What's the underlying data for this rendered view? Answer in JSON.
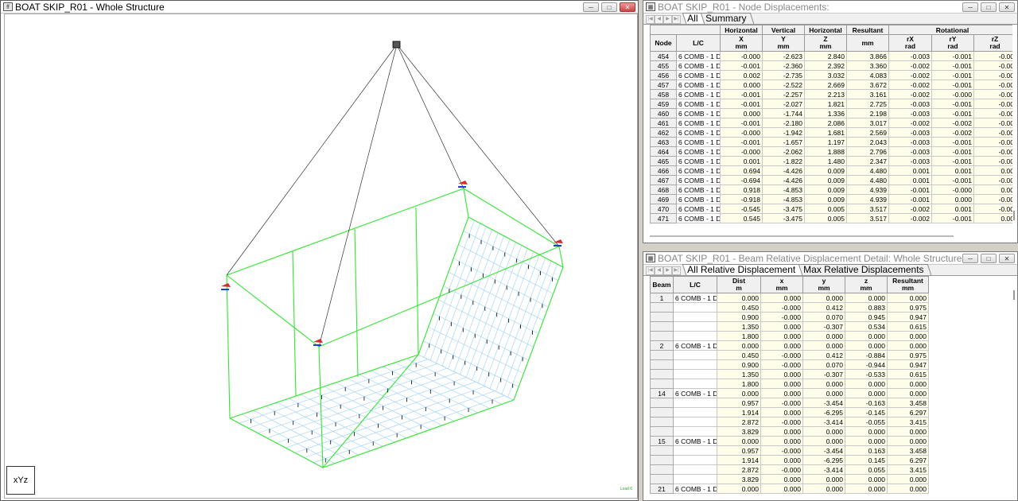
{
  "structure_window": {
    "title": "BOAT SKIP_R01 - Whole Structure",
    "axes_label": "xYz",
    "load_label": "Load 6"
  },
  "node_window": {
    "title": "BOAT SKIP_R01 - Node Displacements:",
    "tabs": [
      "All",
      "Summary"
    ],
    "group_headers": [
      "Horizontal",
      "Vertical",
      "Horizontal",
      "Resultant",
      "Rotational"
    ],
    "col_headers": [
      {
        "name": "Node",
        "unit": ""
      },
      {
        "name": "L/C",
        "unit": ""
      },
      {
        "name": "X",
        "unit": "mm"
      },
      {
        "name": "Y",
        "unit": "mm"
      },
      {
        "name": "Z",
        "unit": "mm"
      },
      {
        "name": "",
        "unit": "mm"
      },
      {
        "name": "rX",
        "unit": "rad"
      },
      {
        "name": "rY",
        "unit": "rad"
      },
      {
        "name": "rZ",
        "unit": "rad"
      }
    ],
    "rows": [
      [
        "454",
        "6 COMB - 1 D",
        "-0.000",
        "-2.623",
        "2.840",
        "3.866",
        "-0.003",
        "-0.001",
        "-0.00"
      ],
      [
        "455",
        "6 COMB - 1 D",
        "-0.001",
        "-2.360",
        "2.392",
        "3.360",
        "-0.002",
        "-0.001",
        "-0.00"
      ],
      [
        "456",
        "6 COMB - 1 D",
        "0.002",
        "-2.735",
        "3.032",
        "4.083",
        "-0.002",
        "-0.001",
        "-0.00"
      ],
      [
        "457",
        "6 COMB - 1 D",
        "0.000",
        "-2.522",
        "2.669",
        "3.672",
        "-0.002",
        "-0.001",
        "-0.00"
      ],
      [
        "458",
        "6 COMB - 1 D",
        "-0.001",
        "-2.257",
        "2.213",
        "3.161",
        "-0.002",
        "-0.000",
        "-0.00"
      ],
      [
        "459",
        "6 COMB - 1 D",
        "-0.001",
        "-2.027",
        "1.821",
        "2.725",
        "-0.003",
        "-0.001",
        "-0.00"
      ],
      [
        "460",
        "6 COMB - 1 D",
        "0.000",
        "-1.744",
        "1.336",
        "2.198",
        "-0.003",
        "-0.001",
        "-0.00"
      ],
      [
        "461",
        "6 COMB - 1 D",
        "-0.001",
        "-2.180",
        "2.086",
        "3.017",
        "-0.002",
        "-0.002",
        "-0.00"
      ],
      [
        "462",
        "6 COMB - 1 D",
        "-0.000",
        "-1.942",
        "1.681",
        "2.569",
        "-0.003",
        "-0.002",
        "-0.00"
      ],
      [
        "463",
        "6 COMB - 1 D",
        "-0.001",
        "-1.657",
        "1.197",
        "2.043",
        "-0.003",
        "-0.001",
        "-0.00"
      ],
      [
        "464",
        "6 COMB - 1 D",
        "-0.000",
        "-2.062",
        "1.888",
        "2.796",
        "-0.003",
        "-0.001",
        "-0.00"
      ],
      [
        "465",
        "6 COMB - 1 D",
        "0.001",
        "-1.822",
        "1.480",
        "2.347",
        "-0.003",
        "-0.001",
        "-0.00"
      ],
      [
        "466",
        "6 COMB - 1 D",
        "0.694",
        "-4.426",
        "0.009",
        "4.480",
        "0.001",
        "0.001",
        "0.00"
      ],
      [
        "467",
        "6 COMB - 1 D",
        "-0.694",
        "-4.426",
        "0.009",
        "4.480",
        "0.001",
        "-0.001",
        "-0.00"
      ],
      [
        "468",
        "6 COMB - 1 D",
        "0.918",
        "-4.853",
        "0.009",
        "4.939",
        "-0.001",
        "-0.000",
        "0.00"
      ],
      [
        "469",
        "6 COMB - 1 D",
        "-0.918",
        "-4.853",
        "0.009",
        "4.939",
        "-0.001",
        "0.000",
        "-0.00"
      ],
      [
        "470",
        "6 COMB - 1 D",
        "-0.545",
        "-3.475",
        "0.005",
        "3.517",
        "-0.002",
        "0.001",
        "-0.00"
      ],
      [
        "471",
        "6 COMB - 1 D",
        "0.545",
        "-3.475",
        "0.005",
        "3.517",
        "-0.002",
        "-0.001",
        "0.00"
      ]
    ]
  },
  "beam_window": {
    "title": "BOAT SKIP_R01 - Beam Relative Displacement Detail: Whole Structure",
    "tabs": [
      "All Relative Displacement",
      "Max Relative Displacements"
    ],
    "col_headers": [
      {
        "name": "Beam",
        "unit": ""
      },
      {
        "name": "L/C",
        "unit": ""
      },
      {
        "name": "Dist",
        "unit": "m"
      },
      {
        "name": "x",
        "unit": "mm"
      },
      {
        "name": "y",
        "unit": "mm"
      },
      {
        "name": "z",
        "unit": "mm"
      },
      {
        "name": "Resultant",
        "unit": "mm"
      }
    ],
    "rows": [
      [
        "1",
        "6 COMB - 1 D",
        "0.000",
        "0.000",
        "0.000",
        "0.000",
        "0.000"
      ],
      [
        "",
        "",
        "0.450",
        "-0.000",
        "0.412",
        "0.883",
        "0.975"
      ],
      [
        "",
        "",
        "0.900",
        "-0.000",
        "0.070",
        "0.945",
        "0.947"
      ],
      [
        "",
        "",
        "1.350",
        "0.000",
        "-0.307",
        "0.534",
        "0.615"
      ],
      [
        "",
        "",
        "1.800",
        "0.000",
        "0.000",
        "0.000",
        "0.000"
      ],
      [
        "2",
        "6 COMB - 1 D",
        "0.000",
        "0.000",
        "0.000",
        "0.000",
        "0.000"
      ],
      [
        "",
        "",
        "0.450",
        "-0.000",
        "0.412",
        "-0.884",
        "0.975"
      ],
      [
        "",
        "",
        "0.900",
        "-0.000",
        "0.070",
        "-0.944",
        "0.947"
      ],
      [
        "",
        "",
        "1.350",
        "0.000",
        "-0.307",
        "-0.533",
        "0.615"
      ],
      [
        "",
        "",
        "1.800",
        "0.000",
        "0.000",
        "0.000",
        "0.000"
      ],
      [
        "14",
        "6 COMB - 1 D",
        "0.000",
        "0.000",
        "0.000",
        "0.000",
        "0.000"
      ],
      [
        "",
        "",
        "0.957",
        "-0.000",
        "-3.454",
        "-0.163",
        "3.458"
      ],
      [
        "",
        "",
        "1.914",
        "0.000",
        "-6.295",
        "-0.145",
        "6.297"
      ],
      [
        "",
        "",
        "2.872",
        "-0.000",
        "-3.414",
        "-0.055",
        "3.415"
      ],
      [
        "",
        "",
        "3.829",
        "0.000",
        "0.000",
        "0.000",
        "0.000"
      ],
      [
        "15",
        "6 COMB - 1 D",
        "0.000",
        "0.000",
        "0.000",
        "0.000",
        "0.000"
      ],
      [
        "",
        "",
        "0.957",
        "-0.000",
        "-3.454",
        "0.163",
        "3.458"
      ],
      [
        "",
        "",
        "1.914",
        "0.000",
        "-6.295",
        "0.145",
        "6.297"
      ],
      [
        "",
        "",
        "2.872",
        "-0.000",
        "-3.414",
        "0.055",
        "3.415"
      ],
      [
        "",
        "",
        "3.829",
        "0.000",
        "0.000",
        "0.000",
        "0.000"
      ],
      [
        "21",
        "6 COMB - 1 D",
        "0.000",
        "0.000",
        "0.000",
        "0.000",
        "0.000"
      ]
    ]
  }
}
